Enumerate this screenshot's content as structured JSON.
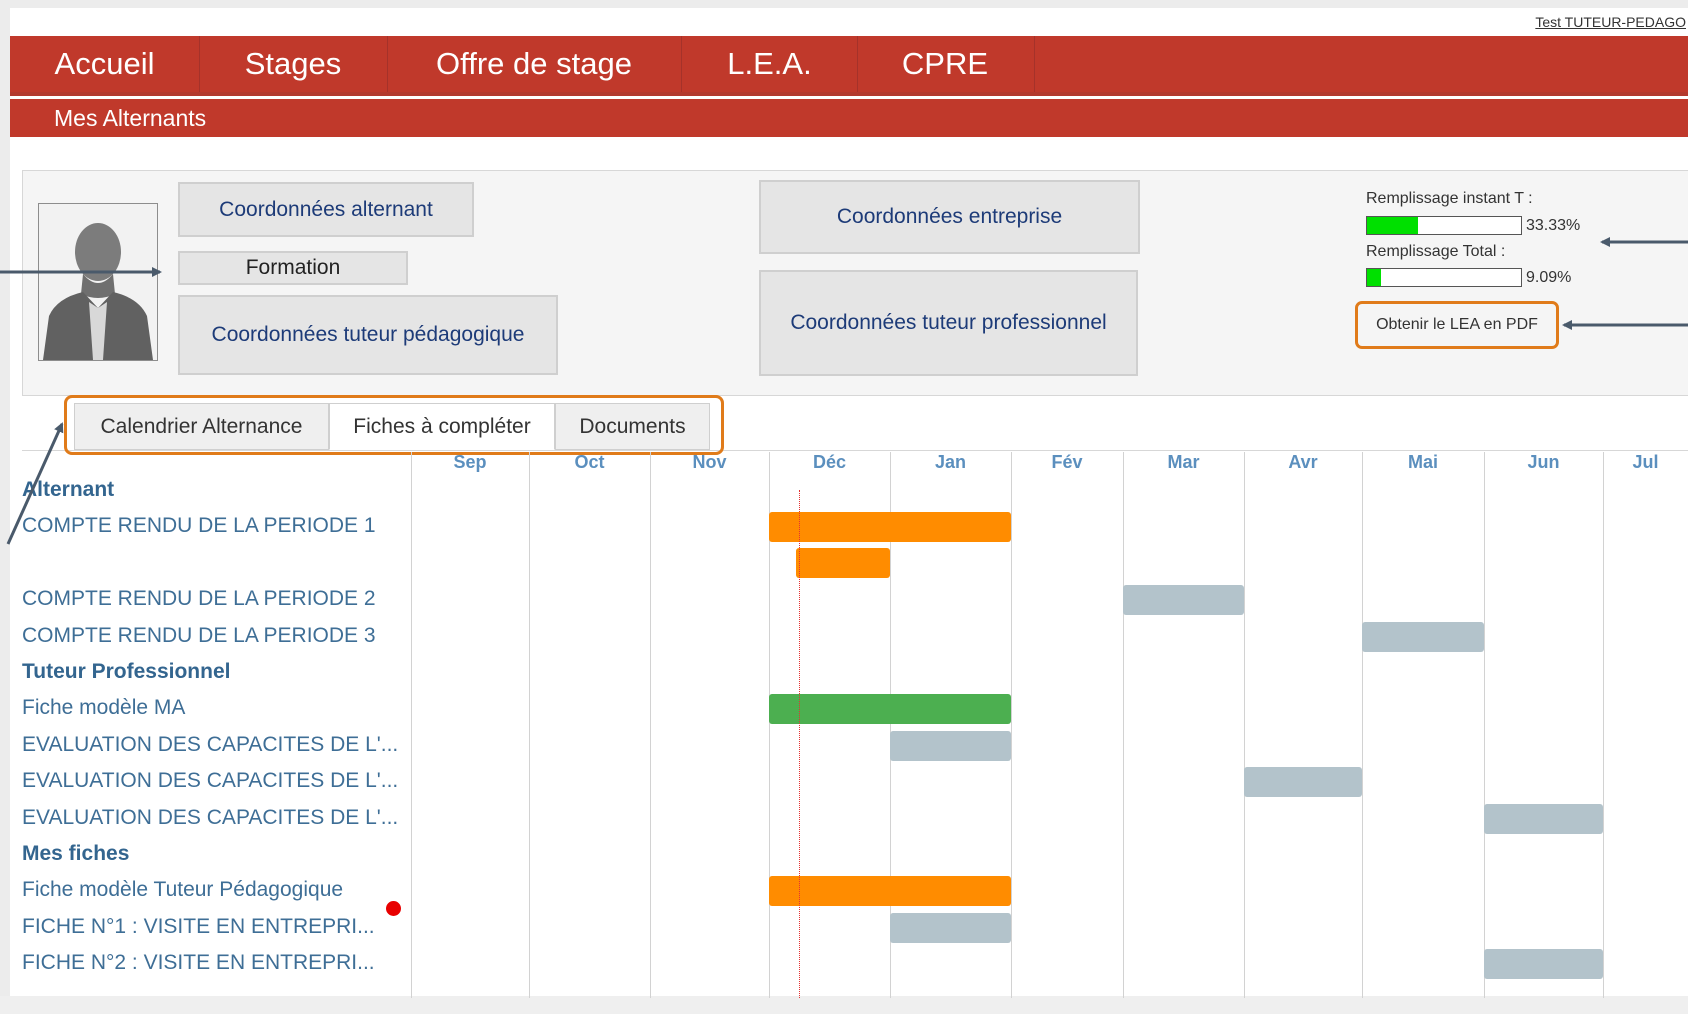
{
  "header": {
    "user_link": "Test TUTEUR-PEDAGO"
  },
  "nav": {
    "items": [
      {
        "label": "Accueil"
      },
      {
        "label": "Stages"
      },
      {
        "label": "Offre de stage"
      },
      {
        "label": "L.E.A."
      },
      {
        "label": "CPRE"
      }
    ],
    "active": "L.E.A."
  },
  "subnav": {
    "label": "Mes Alternants"
  },
  "profile": {
    "buttons": {
      "coord_alternant": "Coordonnées alternant",
      "formation": "Formation",
      "coord_tuteur_pedago": "Coordonnées tuteur pédagogique",
      "coord_entreprise": "Coordonnées entreprise",
      "coord_tuteur_pro": "Coordonnées tuteur professionnel"
    },
    "progress": {
      "instant": {
        "label": "Remplissage instant T :",
        "value": "33.33%",
        "fraction": 0.3333
      },
      "total": {
        "label": "Remplissage Total :",
        "value": "9.09%",
        "fraction": 0.0909
      },
      "fill_color": "#00e000"
    },
    "pdf_link": "Obtenir le LEA en PDF"
  },
  "tabs": [
    {
      "label": "Calendrier Alternance",
      "active": false
    },
    {
      "label": "Fiches à compléter",
      "active": true
    },
    {
      "label": "Documents",
      "active": false
    }
  ],
  "gantt": {
    "months": [
      "Sep",
      "Oct",
      "Nov",
      "Déc",
      "Jan",
      "Fév",
      "Mar",
      "Avr",
      "Mai",
      "Jun",
      "Jul"
    ],
    "colors": {
      "orange": "#ff8c00",
      "grey": "#b3c3cb",
      "green": "#4caf50",
      "highlight": "#e07b1a"
    },
    "rows": [
      {
        "label": "Alternant",
        "section": true
      },
      {
        "label": "COMPTE RENDU DE LA PERIODE 1",
        "bar": {
          "start": "Déc",
          "end": "Jan",
          "color": "orange"
        }
      },
      {
        "label": "",
        "bar": {
          "start": "Déc",
          "end": "Déc",
          "color": "orange"
        }
      },
      {
        "label": "COMPTE RENDU DE LA PERIODE 2",
        "bar": {
          "start": "Mar",
          "end": "Mar",
          "color": "grey"
        }
      },
      {
        "label": "COMPTE RENDU DE LA PERIODE 3",
        "bar": {
          "start": "Mai",
          "end": "Mai",
          "color": "grey"
        }
      },
      {
        "label": "Tuteur Professionnel",
        "section": true
      },
      {
        "label": "Fiche modèle MA",
        "bar": {
          "start": "Déc",
          "end": "Jan",
          "color": "green"
        }
      },
      {
        "label": "EVALUATION DES CAPACITES DE L'...",
        "bar": {
          "start": "Jan",
          "end": "Jan",
          "color": "grey"
        }
      },
      {
        "label": "EVALUATION DES CAPACITES DE L'...",
        "bar": {
          "start": "Avr",
          "end": "Avr",
          "color": "grey"
        }
      },
      {
        "label": "EVALUATION DES CAPACITES DE L'...",
        "bar": {
          "start": "Jun",
          "end": "Jun",
          "color": "grey"
        }
      },
      {
        "label": "Mes fiches",
        "section": true
      },
      {
        "label": "Fiche modèle Tuteur Pédagogique",
        "bar": {
          "start": "Déc",
          "end": "Jan",
          "color": "orange"
        },
        "flag": true
      },
      {
        "label": "FICHE N°1 : VISITE EN ENTREPRI...",
        "bar": {
          "start": "Jan",
          "end": "Jan",
          "color": "grey"
        }
      },
      {
        "label": "FICHE N°2 : VISITE EN ENTREPRI...",
        "bar": {
          "start": "Jun",
          "end": "Jun",
          "color": "grey"
        }
      }
    ]
  }
}
